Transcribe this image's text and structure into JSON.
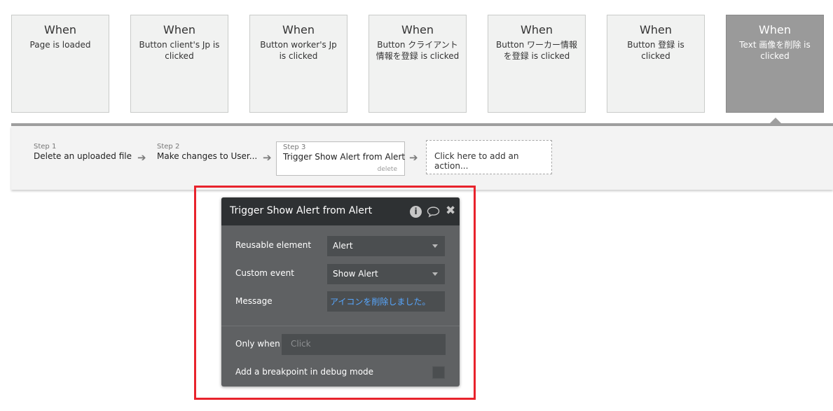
{
  "events": [
    {
      "when": "When",
      "desc": "Page is loaded"
    },
    {
      "when": "When",
      "desc": "Button client's Jp is clicked"
    },
    {
      "when": "When",
      "desc": "Button worker's Jp is clicked"
    },
    {
      "when": "When",
      "desc": "Button クライアント情報を登録 is clicked"
    },
    {
      "when": "When",
      "desc": "Button ワーカー情報を登録 is clicked"
    },
    {
      "when": "When",
      "desc": "Button 登録 is clicked"
    },
    {
      "when": "When",
      "desc": "Text 画像を削除 is clicked"
    }
  ],
  "steps": [
    {
      "num": "Step 1",
      "title": "Delete an uploaded file"
    },
    {
      "num": "Step 2",
      "title": "Make changes to User..."
    },
    {
      "num": "Step 3",
      "title": "Trigger Show Alert from Alert",
      "delete_label": "delete"
    }
  ],
  "add_action_label": "Click here to add an action...",
  "panel": {
    "title": "Trigger Show Alert from Alert",
    "info_glyph": "i",
    "reusable_label": "Reusable element",
    "reusable_value": "Alert",
    "custom_event_label": "Custom event",
    "custom_event_value": "Show Alert",
    "message_label": "Message",
    "message_value": "アイコンを削除しました。",
    "only_when_label": "Only when",
    "only_when_placeholder": "Click",
    "breakpoint_label": "Add a breakpoint in debug mode"
  },
  "colors": {
    "highlight": "#e8232c",
    "selected_card": "#9a9a9a",
    "panel_bg": "#5f6163",
    "panel_header": "#2e3133",
    "message_text": "#57a7ff"
  }
}
